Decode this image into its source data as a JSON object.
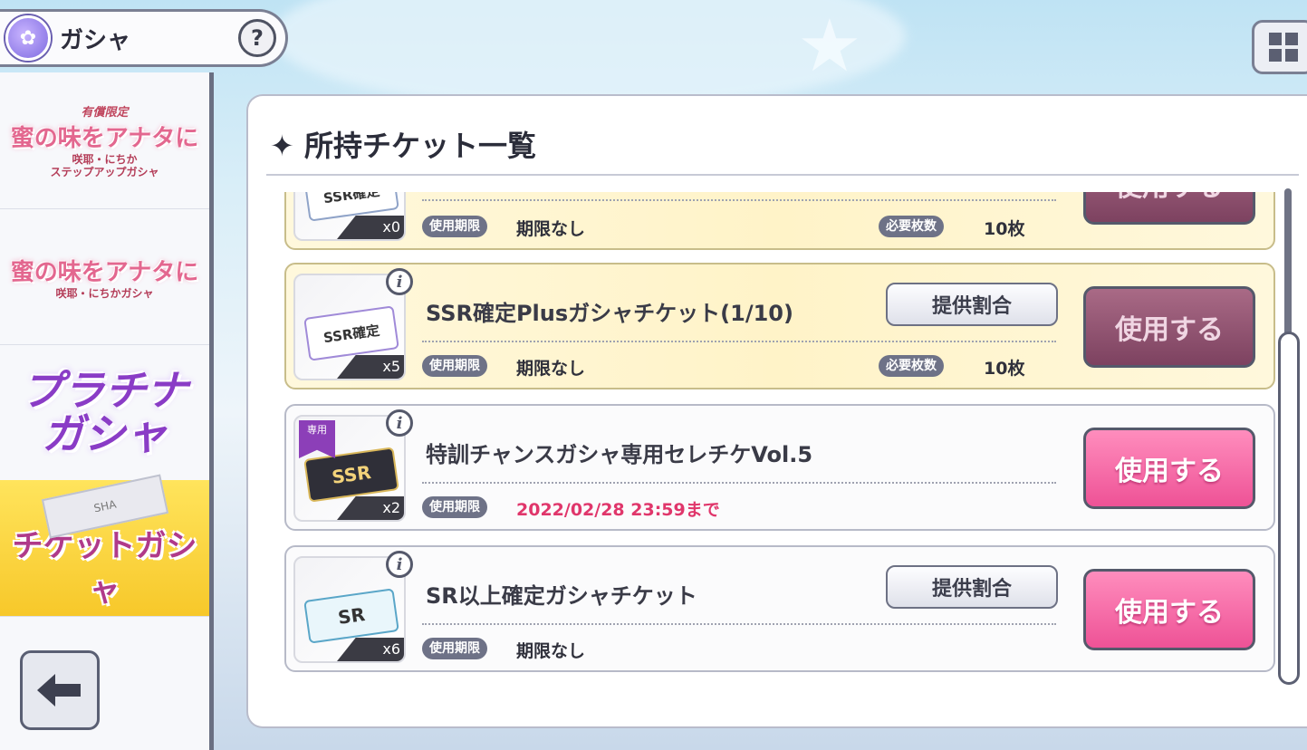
{
  "header": {
    "title": "ガシャ",
    "help_label": "?"
  },
  "sidebar": {
    "items": [
      {
        "small": "有償限定",
        "logo": "蜜の味をアナタに",
        "sub1": "咲耶・にちか",
        "sub2": "ステップアップガシャ"
      },
      {
        "logo": "蜜の味をアナタに",
        "sub1": "咲耶・にちかガシャ"
      },
      {
        "line1": "プラチナ",
        "line2": "ガシャ"
      },
      {
        "label": "チケットガシャ",
        "ticket_text": "SHA"
      }
    ]
  },
  "panel": {
    "title": "所持チケット一覧"
  },
  "labels": {
    "expiry": "使用期限",
    "required": "必要枚数",
    "use": "使用する",
    "rate": "提供割合"
  },
  "tickets": [
    {
      "name": "",
      "thumb_text": "SSR確定",
      "count": "x0",
      "expiry": "期限なし",
      "required": "10枚"
    },
    {
      "name": "SSR確定Plusガシャチケット(1/10)",
      "thumb_text": "SSR確定",
      "count": "x5",
      "expiry": "期限なし",
      "required": "10枚"
    },
    {
      "name": "特訓チャンスガシャ専用セレチケVol.5",
      "thumb_text": "SSR",
      "tag": "専用",
      "count": "x2",
      "expiry": "2022/02/28 23:59まで"
    },
    {
      "name": "SR以上確定ガシャチケット",
      "thumb_text": "SR",
      "count": "x6",
      "expiry": "期限なし"
    }
  ],
  "colors": {
    "accent_pink": "#ee5296",
    "expiry_red": "#e0366b",
    "highlight_bg": "#fff3c8"
  }
}
